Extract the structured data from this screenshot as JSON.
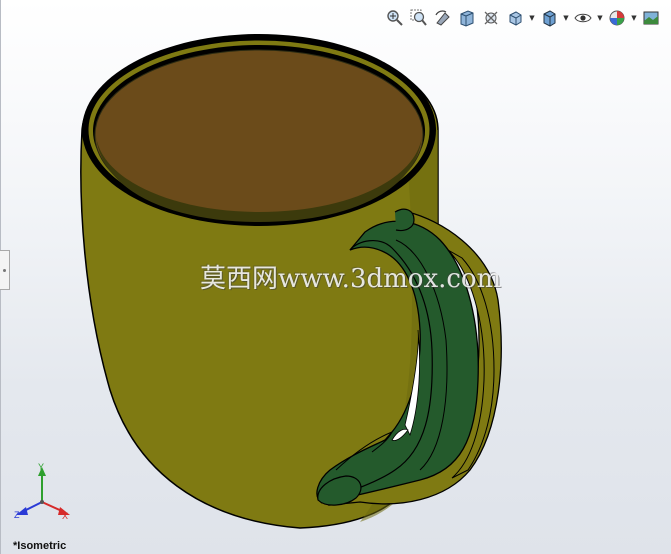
{
  "app": {
    "view_orientation": "*Isometric",
    "watermark": "莫西网www.3dmox.com"
  },
  "toolbar": {
    "items": [
      {
        "name": "zoom-to-fit",
        "icon": "zoom-fit-icon"
      },
      {
        "name": "zoom-to-area",
        "icon": "zoom-area-icon"
      },
      {
        "name": "previous-view",
        "icon": "previous-view-icon"
      },
      {
        "name": "section-view",
        "icon": "section-view-icon"
      },
      {
        "name": "dynamic-annotation-views",
        "icon": "annotation-view-icon"
      },
      {
        "name": "view-orientation",
        "icon": "view-orientation-icon",
        "dropdown": true
      },
      {
        "name": "display-style",
        "icon": "display-style-icon",
        "dropdown": true
      },
      {
        "name": "hide-show-items",
        "icon": "hide-show-icon",
        "dropdown": true
      },
      {
        "name": "edit-appearance",
        "icon": "appearance-icon",
        "dropdown": true
      },
      {
        "name": "apply-scene",
        "icon": "scene-icon"
      }
    ]
  },
  "triad": {
    "x_label": "X",
    "y_label": "Y",
    "z_label": "Z"
  },
  "model": {
    "body_color": "#7f7a12",
    "interior_color": "#6b4b1a",
    "handle_color": "#245a2c"
  }
}
